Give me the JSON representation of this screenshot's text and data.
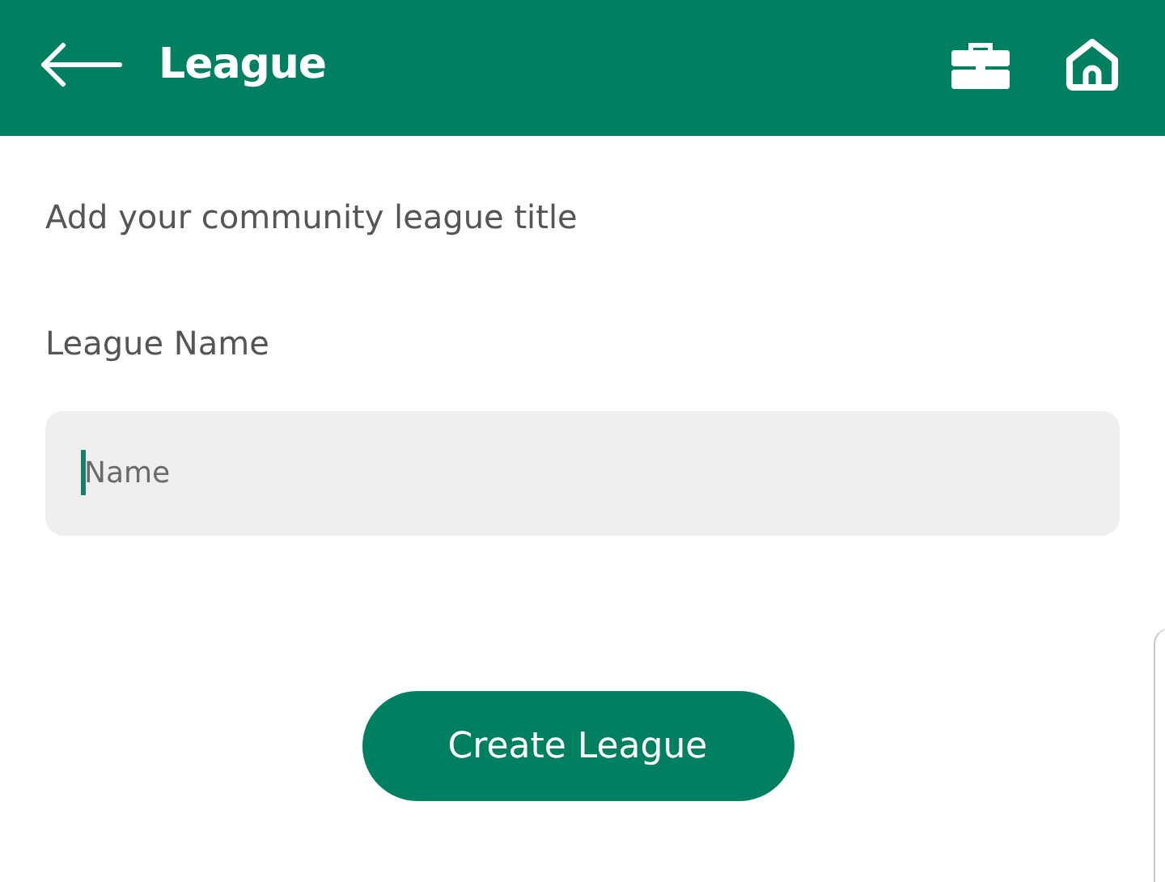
{
  "header": {
    "title": "League"
  },
  "form": {
    "intro": "Add your community league title",
    "field_label": "League Name",
    "field": {
      "placeholder": "Name",
      "focused": true
    }
  },
  "button": {
    "label": "Create League"
  }
}
